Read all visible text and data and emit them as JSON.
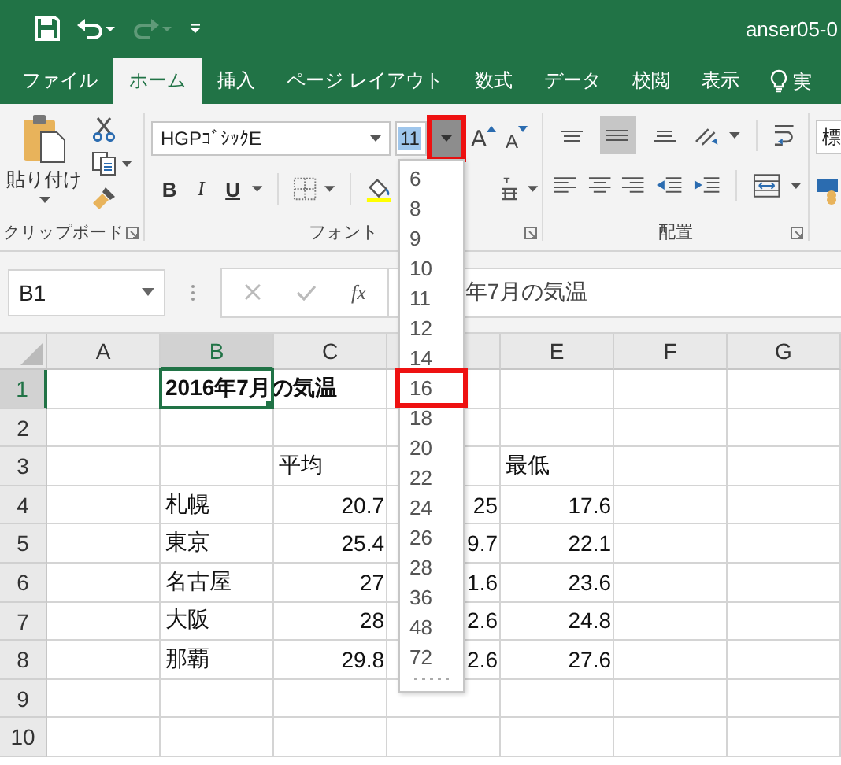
{
  "window": {
    "title": "anser05-0"
  },
  "quick_access": [
    {
      "kind": "save",
      "disabled": false
    },
    {
      "kind": "undo",
      "disabled": false
    },
    {
      "kind": "redo",
      "disabled": true
    },
    {
      "kind": "customize",
      "disabled": false
    }
  ],
  "tabs": [
    {
      "label": "ファイル",
      "selected": false,
      "kind": "tab"
    },
    {
      "label": "ホーム",
      "selected": true,
      "kind": "tab"
    },
    {
      "label": "挿入",
      "selected": false,
      "kind": "tab"
    },
    {
      "label": "ページ レイアウト",
      "selected": false,
      "kind": "tab"
    },
    {
      "label": "数式",
      "selected": false,
      "kind": "tab"
    },
    {
      "label": "データ",
      "selected": false,
      "kind": "tab"
    },
    {
      "label": "校閲",
      "selected": false,
      "kind": "tab"
    },
    {
      "label": "表示",
      "selected": false,
      "kind": "tab"
    },
    {
      "label": "実",
      "selected": false,
      "kind": "tell-me"
    }
  ],
  "ribbon": {
    "clipboard": {
      "paste_label": "貼り付け",
      "group_label": "クリップボード"
    },
    "font": {
      "font_name": "HGPｺﾞｼｯｸE",
      "font_size": "11",
      "grow_label": "A",
      "shrink_label": "A",
      "bold_label": "B",
      "italic_label": "I",
      "underline_label": "U",
      "group_label": "フォント",
      "size_dropdown": {
        "open": true,
        "highlighted": true
      },
      "size_options": [
        {
          "label": "6",
          "highlighted": false
        },
        {
          "label": "8",
          "highlighted": false
        },
        {
          "label": "9",
          "highlighted": false
        },
        {
          "label": "10",
          "highlighted": false
        },
        {
          "label": "11",
          "highlighted": false
        },
        {
          "label": "12",
          "highlighted": false
        },
        {
          "label": "14",
          "highlighted": false
        },
        {
          "label": "16",
          "highlighted": true
        },
        {
          "label": "18",
          "highlighted": false
        },
        {
          "label": "20",
          "highlighted": false
        },
        {
          "label": "22",
          "highlighted": false
        },
        {
          "label": "24",
          "highlighted": false
        },
        {
          "label": "26",
          "highlighted": false
        },
        {
          "label": "28",
          "highlighted": false
        },
        {
          "label": "36",
          "highlighted": false
        },
        {
          "label": "48",
          "highlighted": false
        },
        {
          "label": "72",
          "highlighted": false
        }
      ]
    },
    "alignment": {
      "group_label": "配置",
      "vertical_align": [
        {
          "kind": "top",
          "selected": false
        },
        {
          "kind": "middle",
          "selected": true
        },
        {
          "kind": "bottom",
          "selected": false
        }
      ]
    },
    "number_format": "標"
  },
  "formula_bar": {
    "name_box": "B1",
    "fx_label": "fx",
    "formula": "年7月の気温"
  },
  "sheet": {
    "columns": [
      {
        "label": "A",
        "selected": false
      },
      {
        "label": "B",
        "selected": true
      },
      {
        "label": "C",
        "selected": false
      },
      {
        "selected": false
      },
      {
        "label": "E",
        "selected": false
      },
      {
        "label": "F",
        "selected": false
      },
      {
        "label": "G",
        "selected": false
      }
    ],
    "rows": [
      {
        "label": "1",
        "selected": true,
        "cells": [
          {
            "kind": "blank"
          },
          {
            "text": "2016年7月の気温",
            "kind": "heading",
            "overflow": true
          },
          {
            "kind": "blank"
          },
          {
            "kind": "blank"
          },
          {
            "kind": "blank"
          },
          {
            "kind": "blank"
          }
        ]
      },
      {
        "label": "2",
        "selected": false,
        "cells": [
          {
            "kind": "blank"
          },
          {
            "kind": "blank"
          },
          {
            "kind": "blank"
          },
          {
            "kind": "blank"
          },
          {
            "kind": "blank"
          },
          {
            "kind": "blank"
          },
          {
            "kind": "blank"
          }
        ]
      },
      {
        "label": "3",
        "selected": false,
        "cells": [
          {
            "kind": "blank"
          },
          {
            "kind": "blank"
          },
          {
            "text": "平均",
            "kind": "text"
          },
          {
            "kind": "blank"
          },
          {
            "text": "最低",
            "kind": "text"
          },
          {
            "kind": "blank"
          },
          {
            "kind": "blank"
          }
        ]
      },
      {
        "label": "4",
        "selected": false,
        "cells": [
          {
            "kind": "blank"
          },
          {
            "text": "札幌",
            "kind": "text"
          },
          {
            "text": "20.7",
            "kind": "number"
          },
          {
            "text": "25",
            "kind": "number"
          },
          {
            "text": "17.6",
            "kind": "number"
          },
          {
            "kind": "blank"
          },
          {
            "kind": "blank"
          }
        ]
      },
      {
        "label": "5",
        "selected": false,
        "cells": [
          {
            "kind": "blank"
          },
          {
            "text": "東京",
            "kind": "text"
          },
          {
            "text": "25.4",
            "kind": "number"
          },
          {
            "text": "9.7",
            "kind": "number"
          },
          {
            "text": "22.1",
            "kind": "number"
          },
          {
            "kind": "blank"
          },
          {
            "kind": "blank"
          }
        ]
      },
      {
        "label": "6",
        "selected": false,
        "cells": [
          {
            "kind": "blank"
          },
          {
            "text": "名古屋",
            "kind": "text"
          },
          {
            "text": "27",
            "kind": "number"
          },
          {
            "text": "1.6",
            "kind": "number"
          },
          {
            "text": "23.6",
            "kind": "number"
          },
          {
            "kind": "blank"
          },
          {
            "kind": "blank"
          }
        ]
      },
      {
        "label": "7",
        "selected": false,
        "cells": [
          {
            "kind": "blank"
          },
          {
            "text": "大阪",
            "kind": "text"
          },
          {
            "text": "28",
            "kind": "number"
          },
          {
            "text": "2.6",
            "kind": "number"
          },
          {
            "text": "24.8",
            "kind": "number"
          },
          {
            "kind": "blank"
          },
          {
            "kind": "blank"
          }
        ]
      },
      {
        "label": "8",
        "selected": false,
        "cells": [
          {
            "kind": "blank"
          },
          {
            "text": "那覇",
            "kind": "text"
          },
          {
            "text": "29.8",
            "kind": "number"
          },
          {
            "text": "2.6",
            "kind": "number"
          },
          {
            "text": "27.6",
            "kind": "number"
          },
          {
            "kind": "blank"
          },
          {
            "kind": "blank"
          }
        ]
      },
      {
        "label": "9",
        "selected": false,
        "cells": [
          {
            "kind": "blank"
          },
          {
            "kind": "blank"
          },
          {
            "kind": "blank"
          },
          {
            "kind": "blank"
          },
          {
            "kind": "blank"
          },
          {
            "kind": "blank"
          },
          {
            "kind": "blank"
          }
        ]
      },
      {
        "label": "10",
        "selected": false,
        "cells": [
          {
            "kind": "blank"
          },
          {
            "kind": "blank"
          },
          {
            "kind": "blank"
          },
          {
            "kind": "blank"
          },
          {
            "kind": "blank"
          },
          {
            "kind": "blank"
          },
          {
            "kind": "blank"
          }
        ]
      }
    ]
  }
}
